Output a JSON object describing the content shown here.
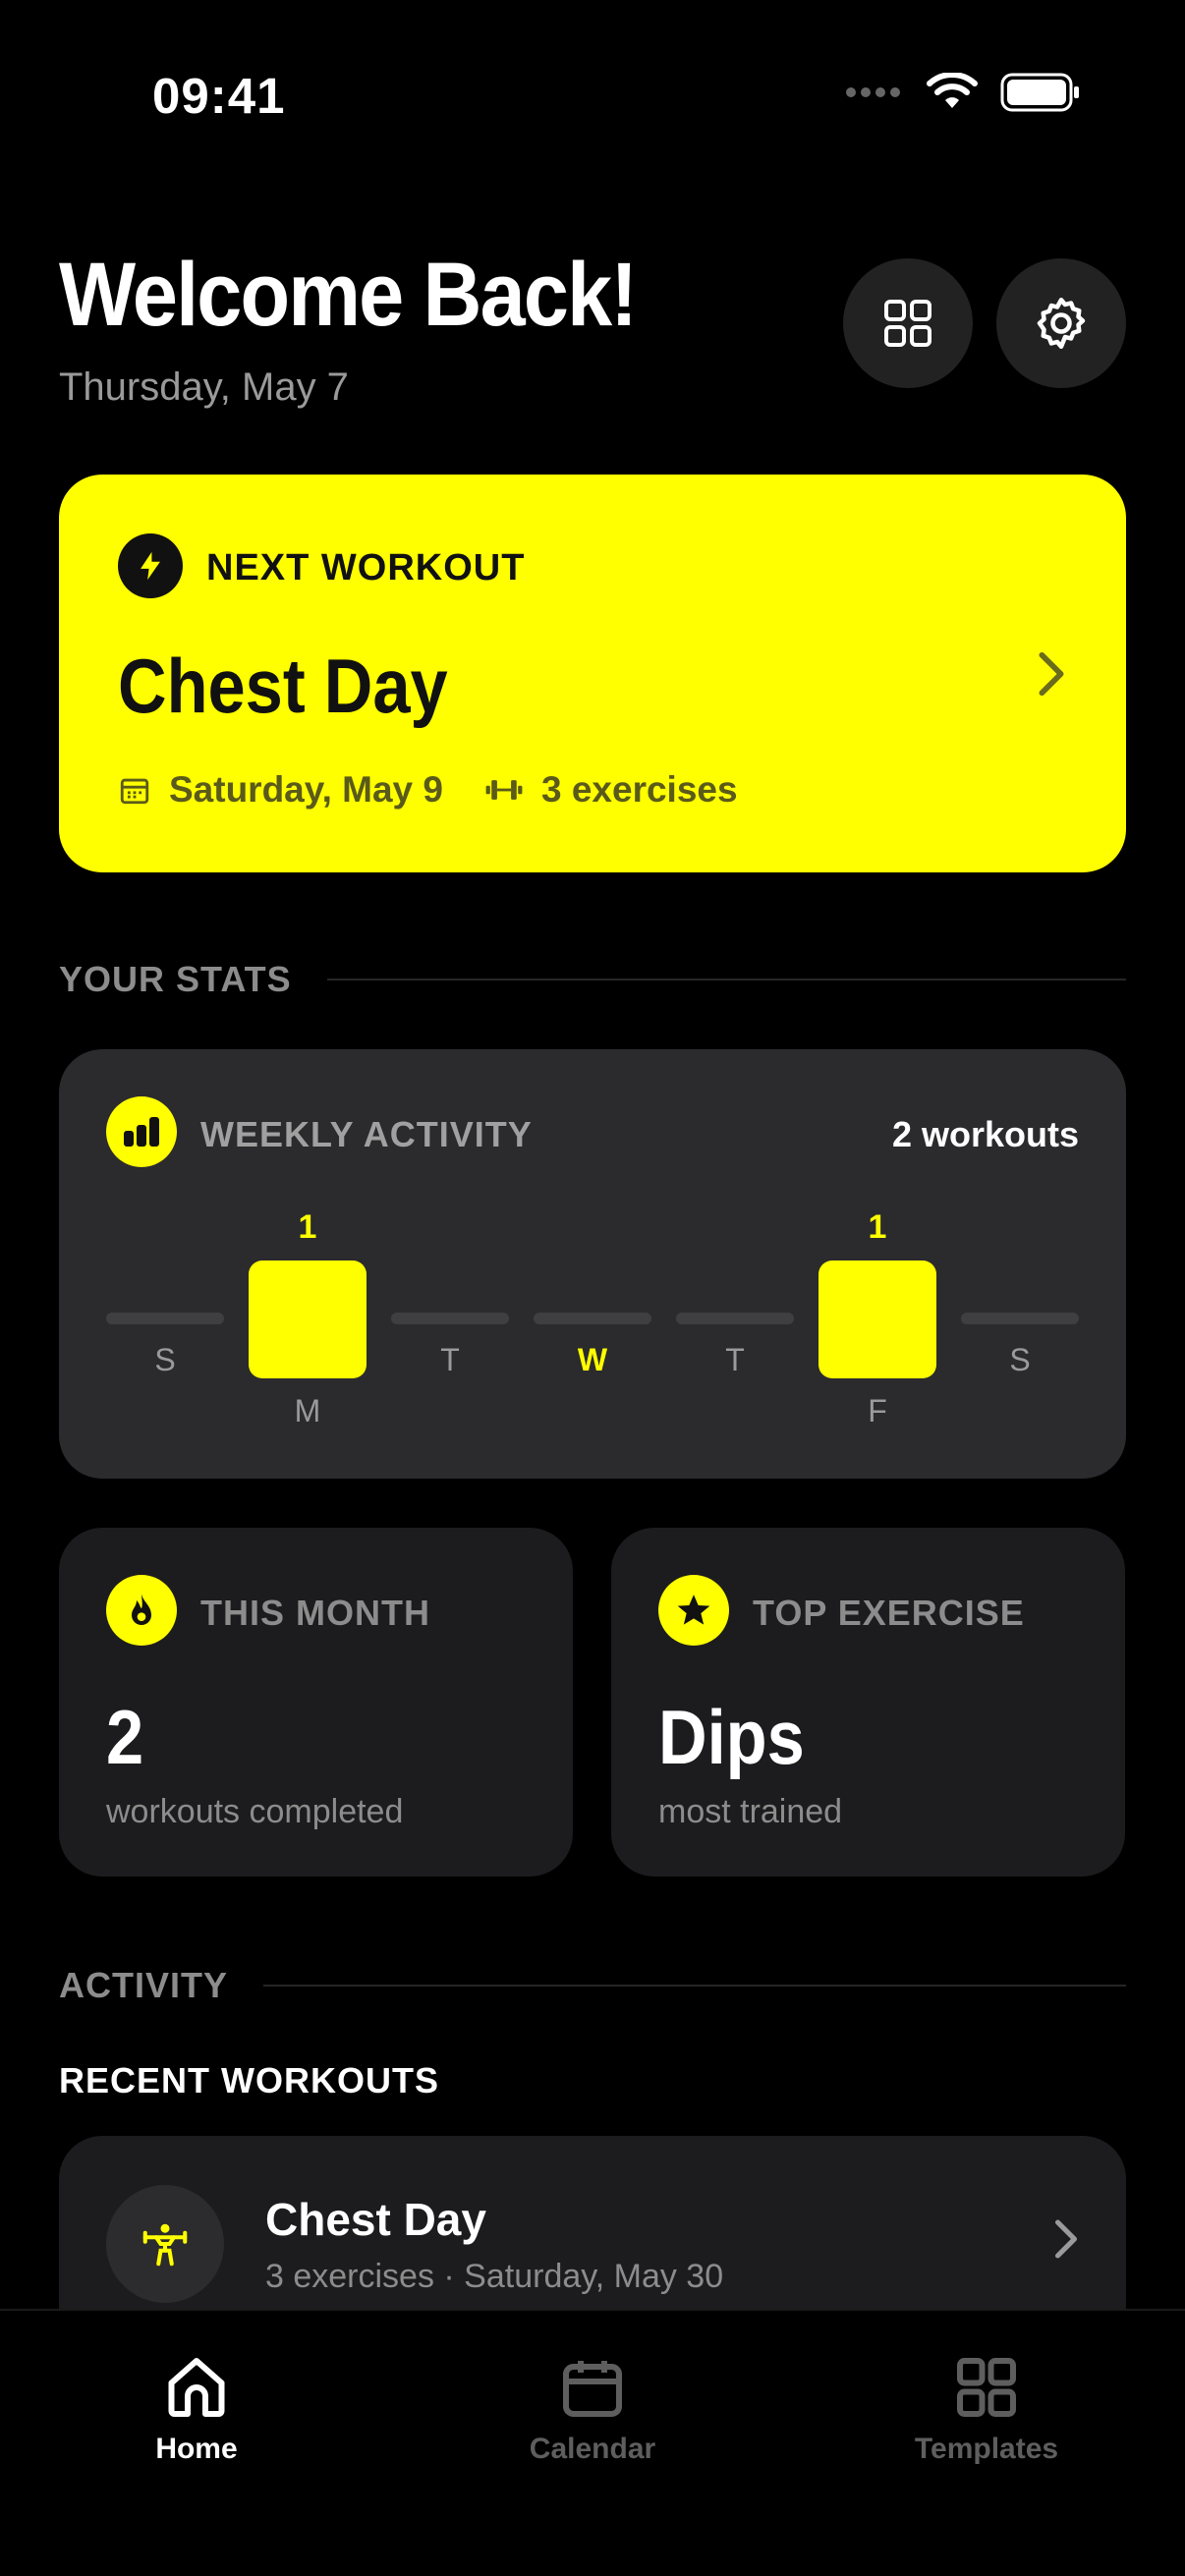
{
  "status_bar": {
    "time": "09:41"
  },
  "header": {
    "title": "Welcome Back!",
    "date": "Thursday, May 7"
  },
  "next_workout": {
    "label": "NEXT WORKOUT",
    "title": "Chest Day",
    "date": "Saturday, May 9",
    "exercises": "3 exercises"
  },
  "sections": {
    "stats": "YOUR STATS",
    "activity": "ACTIVITY"
  },
  "weekly_activity": {
    "label": "WEEKLY ACTIVITY",
    "count": "2 workouts",
    "days": [
      {
        "label": "S",
        "value": 0
      },
      {
        "label": "M",
        "value": 1,
        "value_text": "1"
      },
      {
        "label": "T",
        "value": 0
      },
      {
        "label": "W",
        "value": 0,
        "today": true
      },
      {
        "label": "T",
        "value": 0
      },
      {
        "label": "F",
        "value": 1,
        "value_text": "1"
      },
      {
        "label": "S",
        "value": 0
      }
    ]
  },
  "this_month": {
    "label": "THIS MONTH",
    "value": "2",
    "caption": "workouts completed"
  },
  "top_exercise": {
    "label": "TOP EXERCISE",
    "value": "Dips",
    "caption": "most trained"
  },
  "recent": {
    "title": "RECENT WORKOUTS",
    "items": [
      {
        "title": "Chest Day",
        "meta": "3 exercises · Saturday, May 30"
      }
    ]
  },
  "tabs": [
    {
      "label": "Home",
      "icon": "home-icon",
      "active": true
    },
    {
      "label": "Calendar",
      "icon": "calendar-icon",
      "active": false
    },
    {
      "label": "Templates",
      "icon": "grid-icon",
      "active": false
    }
  ],
  "colors": {
    "accent": "#ffff00",
    "background": "#000000",
    "card": "#1c1c1e"
  }
}
